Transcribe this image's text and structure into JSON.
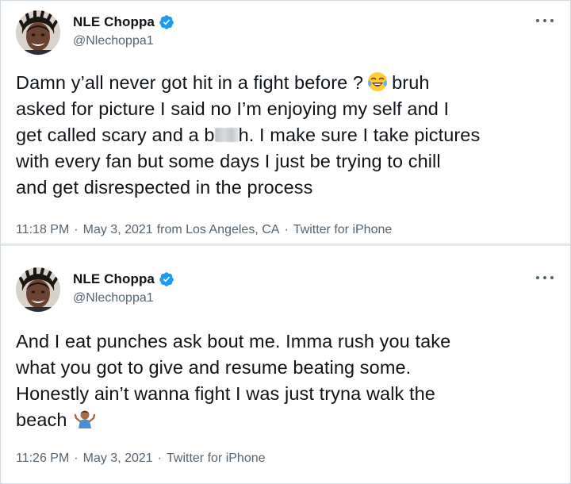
{
  "tweets": [
    {
      "display_name": "NLE Choppa",
      "handle": "@Nlechoppa1",
      "text_line_1_a": "Damn y’all never got hit in a fight before ?",
      "emoji_1": "tears-of-joy-emoji",
      "text_line_1_b": "bruh",
      "text_rest_a": "asked for picture I said no I’m enjoying my self and I\nget called scary and a b",
      "censored": "blurred-word",
      "text_rest_b": "h. I make sure I take pictures\nwith every fan but some days I just be trying to chill\nand get disrespected in the process",
      "time": "11:18 PM",
      "date": "May 3, 2021",
      "location": "from Los Angeles, CA",
      "source": "Twitter for iPhone"
    },
    {
      "display_name": "NLE Choppa",
      "handle": "@Nlechoppa1",
      "text": "And I eat punches ask bout me. Imma rush you take\nwhat you got to give and resume beating some.\nHonestly ain’t wanna fight I was just tryna walk the\nbeach",
      "emoji_1": "man-shrugging-emoji",
      "time": "11:26 PM",
      "date": "May 3, 2021",
      "source": "Twitter for iPhone"
    }
  ],
  "separator": "·",
  "colors": {
    "text": "#0f1419",
    "secondary": "#536471",
    "verified": "#1d9bf0",
    "divider": "#e6ecf0"
  }
}
